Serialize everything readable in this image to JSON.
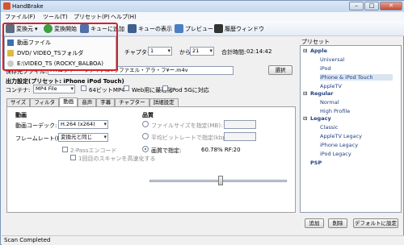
{
  "window": {
    "title": "HandBrake"
  },
  "menubar": [
    "ファイル(F)",
    "ツール(T)",
    "プリセット(P)",
    "ヘルプ(H)"
  ],
  "toolbar": {
    "source": "変換元",
    "start": "変換開始",
    "add_queue": "キューに追加",
    "show_queue": "キューの表示",
    "preview": "プレビュー",
    "activity": "履歴ウィンドウ"
  },
  "dropdown": {
    "items": [
      "動画ファイル",
      "DVD/ VIDEO_TSフォルダ",
      "E:\\VIDEO_TS (ROCKY_BALBOA)"
    ]
  },
  "source_row": {
    "chapters_label": "チャプター:",
    "chapter_start": "1",
    "to_label": "から",
    "chapter_end": "21",
    "duration_label": "合計時間:",
    "duration": "02:14:42"
  },
  "destination": {
    "label": "保存先ファイル:",
    "path": "F:¥ロッキー・ファイナル¥ラファエル・アラ・フ¥ー.m4v",
    "browse": "選択"
  },
  "output_settings": {
    "heading": "出力設定(プリセット: iPhone iPod Touch)",
    "container_label": "コンテナ:",
    "container": "MP4 File",
    "mp4_64bit": "64ビットMP4",
    "web_optimized": "Web用に最適化",
    "ipod_5g": "iPod 5Gに対応"
  },
  "tabs": [
    "サイズ",
    "フィルタ",
    "動画",
    "音声",
    "字幕",
    "チャプター",
    "詳細設定"
  ],
  "video": {
    "section": "動画",
    "codec_label": "動画コーデック:",
    "codec": "H.264 (x264)",
    "fps_label": "フレームレート(FPS):",
    "fps": "変換元と同じ",
    "twopass": "2-Passエンコード",
    "turbo": "1回目のスキャンを高速化する"
  },
  "quality": {
    "section": "品質",
    "target_size": "ファイルサイズを指定(MB):",
    "avg_bitrate": "平均ビットレートで指定(kbps):",
    "constant_quality": "画質で指定:",
    "rf_value": "60.78% RF:20",
    "slider_level": 0.52
  },
  "presets": {
    "title": "プリセット",
    "groups": [
      {
        "name": "Apple",
        "items": [
          "Universal",
          "iPod",
          "iPhone & iPod Touch",
          "AppleTV"
        ]
      },
      {
        "name": "Regular",
        "items": [
          "Normal",
          "High Profile"
        ]
      },
      {
        "name": "Legacy",
        "items": [
          "Classic",
          "AppleTV Legacy",
          "iPhone Legacy",
          "iPod Legacy"
        ]
      }
    ],
    "standalone": "PSP",
    "selected": "iPhone & iPod Touch",
    "buttons": {
      "add": "追加",
      "remove": "削除",
      "default": "デフォルトに設定"
    }
  },
  "status": "Scan Completed",
  "colors": {
    "highlight": "#d6202a",
    "titlebar": "#c6d8ef",
    "selection": "#d9e4f1"
  }
}
